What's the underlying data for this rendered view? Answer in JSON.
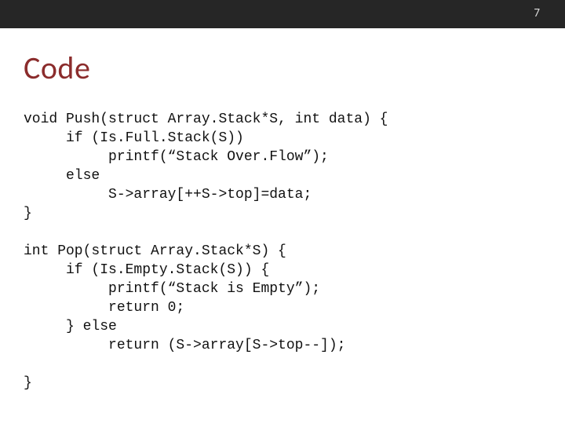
{
  "header": {
    "page_number": "7",
    "title": "Code"
  },
  "body": {
    "code": "void Push(struct Array.Stack*S, int data) {\n     if (Is.Full.Stack(S))\n          printf(“Stack Over.Flow”);\n     else\n          S->array[++S->top]=data;\n}\n\nint Pop(struct Array.Stack*S) {\n     if (Is.Empty.Stack(S)) {\n          printf(“Stack is Empty”);\n          return 0;\n     } else\n          return (S->array[S->top--]);\n\n}"
  }
}
